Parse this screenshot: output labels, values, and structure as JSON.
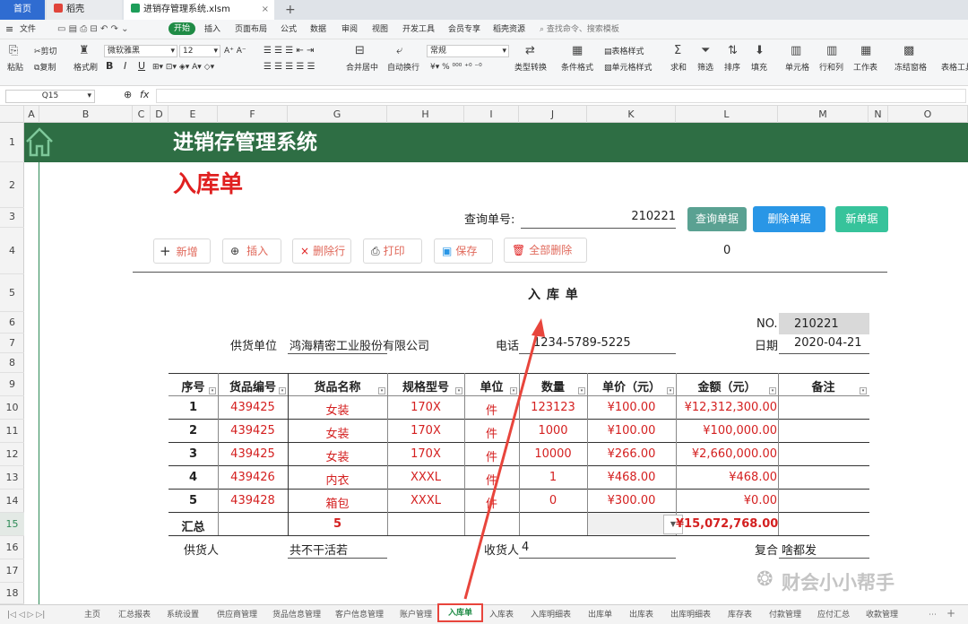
{
  "tabs": {
    "home": "首页",
    "docer": "稻壳",
    "file": "进销存管理系统.xlsm"
  },
  "menus": [
    "文件",
    "开始",
    "插入",
    "页面布局",
    "公式",
    "数据",
    "审阅",
    "视图",
    "开发工具",
    "会员专享",
    "稻壳资源"
  ],
  "menu_search": "查找命令、搜索模板",
  "ribbon": {
    "cut": "剪切",
    "paste": "粘贴",
    "copy": "复制",
    "format_painter": "格式刷",
    "font": "微软雅黑",
    "size": "12",
    "merge": "合并居中",
    "wrap": "自动换行",
    "numfmt": "常规",
    "convert": "类型转换",
    "cond_fmt": "条件格式",
    "table_style": "表格样式",
    "cell_style": "单元格样式",
    "sum": "求和",
    "filter": "筛选",
    "sort": "排序",
    "fill": "填充",
    "cell": "单元格",
    "rowcol": "行和列",
    "sheet": "工作表",
    "freeze": "冻结窗格",
    "tools": "表格工具",
    "bold": "B",
    "italic": "I",
    "underline": "U",
    "pct": "%"
  },
  "namebox": "Q15",
  "fx": "fx",
  "columns": [
    "A",
    "B",
    "C",
    "D",
    "E",
    "F",
    "G",
    "H",
    "I",
    "J",
    "K",
    "L",
    "M",
    "N",
    "O"
  ],
  "rows": [
    "1",
    "2",
    "3",
    "4",
    "5",
    "6",
    "7",
    "8",
    "9",
    "10",
    "11",
    "12",
    "13",
    "14",
    "15",
    "16",
    "17",
    "18"
  ],
  "sheet": {
    "banner": "进销存管理系统",
    "doc_title": "入库单",
    "query_label": "查询单号:",
    "query_value": "210221",
    "btn_query": "查询单据",
    "btn_delete_doc": "删除单据",
    "btn_new": "新单据",
    "btn_add": "新增",
    "btn_insert": "插入",
    "btn_delrow": "删除行",
    "btn_print": "打印",
    "btn_save": "保存",
    "btn_clear": "全部删除",
    "counter": "0",
    "form_title": "入 库 单",
    "no_label": "NO.",
    "no_value": "210221",
    "supplier_label": "供货单位",
    "supplier_value": "鸿海精密工业股份有限公司",
    "phone_label": "电话",
    "phone_value": "1234-5789-5225",
    "date_label": "日期",
    "date_value": "2020-04-21",
    "headers": [
      "序号",
      "货品编号",
      "货品名称",
      "规格型号",
      "单位",
      "数量",
      "单价（元）",
      "金额（元）",
      "备注"
    ],
    "items": [
      [
        "1",
        "439425",
        "女装",
        "170X",
        "件",
        "123123",
        "¥100.00",
        "¥12,312,300.00",
        ""
      ],
      [
        "2",
        "439425",
        "女装",
        "170X",
        "件",
        "1000",
        "¥100.00",
        "¥100,000.00",
        ""
      ],
      [
        "3",
        "439425",
        "女装",
        "170X",
        "件",
        "10000",
        "¥266.00",
        "¥2,660,000.00",
        ""
      ],
      [
        "4",
        "439426",
        "内衣",
        "XXXL",
        "件",
        "1",
        "¥468.00",
        "¥468.00",
        ""
      ],
      [
        "5",
        "439428",
        "箱包",
        "XXXL",
        "件",
        "0",
        "¥300.00",
        "¥0.00",
        ""
      ]
    ],
    "total_label": "汇总",
    "total_count": "5",
    "total_amount": "¥15,072,768.00",
    "giver_label": "供货人",
    "giver_value": "共不干活若",
    "receiver_label": "收货人",
    "receiver_value": "4",
    "review_label": "复合",
    "review_value": "啥都发"
  },
  "watermark": "财会小小帮手",
  "sheet_tabs": [
    "主页",
    "汇总报表",
    "系统设置",
    "供应商管理",
    "货品信息管理",
    "客户信息管理",
    "账户管理",
    "入库单",
    "入库表",
    "入库明细表",
    "出库单",
    "出库表",
    "出库明细表",
    "库存表",
    "付款管理",
    "应付汇总",
    "收款管理"
  ],
  "active_sheet": "入库单",
  "colors": {
    "banner": "#2e6e44",
    "title_red": "#e02020",
    "item_red": "#d42020",
    "btn_teal": "#5aa192",
    "btn_blue": "#2996e6",
    "btn_green": "#37c39b",
    "highlight": "#e8453c"
  }
}
